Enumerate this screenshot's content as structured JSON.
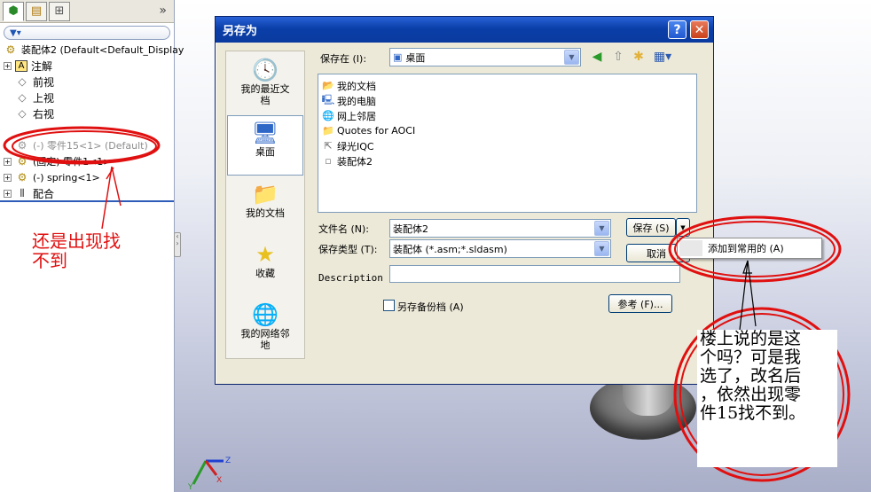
{
  "panel": {
    "tabs": [
      {
        "icon": "feature-manager-icon"
      },
      {
        "icon": "property-manager-icon"
      },
      {
        "icon": "configuration-manager-icon"
      }
    ],
    "expand_icon": "»",
    "filter_icon": "filter-icon"
  },
  "tree": {
    "items": [
      {
        "label": "装配体2  (Default<Default_Display",
        "icon": "assembly-icon",
        "expandable": false
      },
      {
        "label": "注解",
        "icon": "annotation-icon",
        "expandable": true
      },
      {
        "label": "前视",
        "icon": "plane-icon",
        "expandable": false
      },
      {
        "label": "上视",
        "icon": "plane-icon",
        "expandable": false
      },
      {
        "label": "右视",
        "icon": "plane-icon",
        "expandable": false
      },
      {
        "label": "(-) 零件15<1> (Default)",
        "icon": "part-icon",
        "expandable": true,
        "color": "#8c8c8c"
      },
      {
        "label": "(固定) 零件1<1>",
        "icon": "part-icon",
        "expandable": true
      },
      {
        "label": "(-) spring<1>",
        "icon": "part-icon",
        "expandable": true
      },
      {
        "label": "配合",
        "icon": "mates-icon",
        "expandable": true
      }
    ]
  },
  "dialog": {
    "title": "另存为",
    "help_label": "?",
    "close_label": "✕",
    "save_in_label": "保存在 (I):",
    "save_in_value": "桌面",
    "places": [
      {
        "label": "我的最近文档",
        "icon": "recent-documents-icon",
        "active": false
      },
      {
        "label": "桌面",
        "icon": "desktop-icon",
        "active": true
      },
      {
        "label": "我的文档",
        "icon": "my-documents-icon",
        "active": false
      },
      {
        "label": "收藏",
        "icon": "favorites-icon",
        "active": false
      },
      {
        "label": "我的网络邻地",
        "icon": "network-places-icon",
        "active": false
      }
    ],
    "files": [
      {
        "name": "我的文档",
        "icon": "folder-icon"
      },
      {
        "name": "我的电脑",
        "icon": "computer-icon"
      },
      {
        "name": "网上邻居",
        "icon": "network-icon"
      },
      {
        "name": "Quotes for AOCI",
        "icon": "folder-icon"
      },
      {
        "name": "绿光IQC",
        "icon": "shortcut-icon"
      },
      {
        "name": "装配体2",
        "icon": "assembly-file-icon"
      }
    ],
    "filename_label": "文件名 (N):",
    "filename_value": "装配体2",
    "filetype_label": "保存类型 (T):",
    "filetype_value": "装配体 (*.asm;*.sldasm)",
    "description_label": "Description",
    "backup_label": "另存备份档 (A)",
    "save_button": "保存 (S)",
    "cancel_button": "取消",
    "browse_button": "参考 (F)..."
  },
  "context_menu": {
    "item": "添加到常用的 (A)"
  },
  "annotations": {
    "left_note": "还是出现找\n不到",
    "right_note": "楼上说的是这\n个吗？可是我\n选了，改名后\n，依然出现零\n件15找不到。",
    "note_color": "#e01010"
  }
}
